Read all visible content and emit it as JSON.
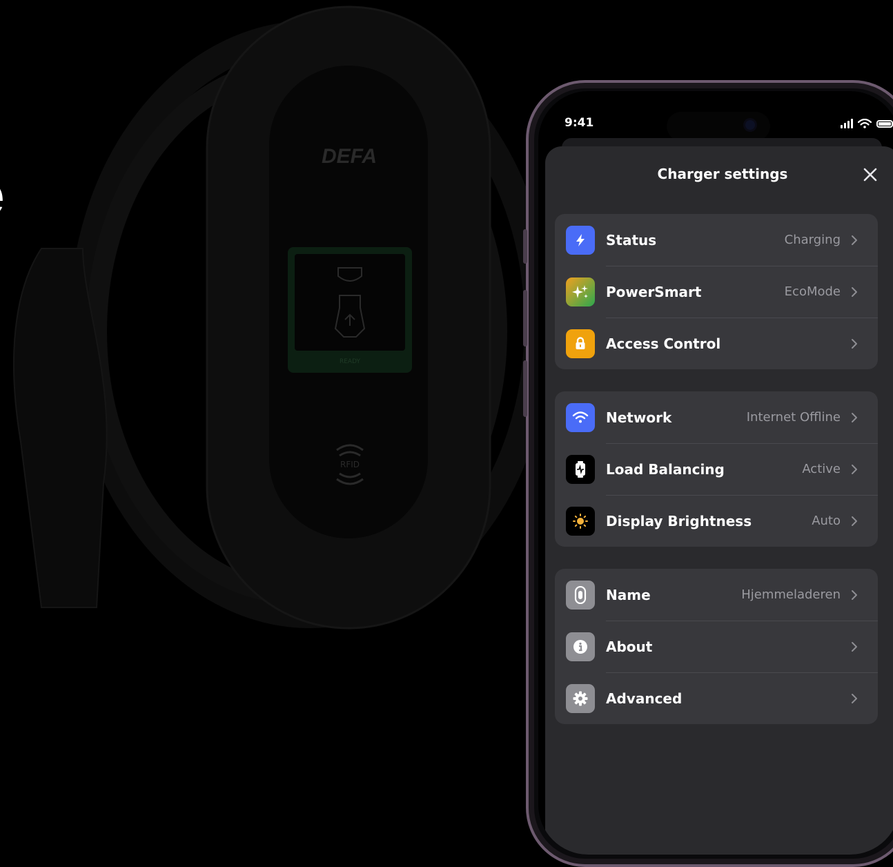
{
  "hero": {
    "line1": "e",
    "line2": "/"
  },
  "charger": {
    "brand": "DEFA",
    "ready_label": "READY",
    "rfid_label": "RFID"
  },
  "status_bar": {
    "time": "9:41"
  },
  "sheet": {
    "title": "Charger settings"
  },
  "groups": [
    [
      {
        "label": "Status",
        "value": "Charging",
        "icon": "lightning-icon",
        "color": "#4a6cf7"
      },
      {
        "label": "PowerSmart",
        "value": "EcoMode",
        "icon": "sparkles-icon",
        "color": "gradient"
      },
      {
        "label": "Access Control",
        "value": "",
        "icon": "lock-icon",
        "color": "#f0a20d"
      }
    ],
    [
      {
        "label": "Network",
        "value": "Internet Offline",
        "icon": "wifi-icon",
        "color": "#4a6cf7"
      },
      {
        "label": "Load Balancing",
        "value": "Active",
        "icon": "load-balancing-icon",
        "color": "#000000"
      },
      {
        "label": "Display Brightness",
        "value": "Auto",
        "icon": "sun-icon",
        "color": "#000000"
      }
    ],
    [
      {
        "label": "Name",
        "value": "Hjemmeladeren",
        "icon": "charger-icon",
        "color": "#8e8e93"
      },
      {
        "label": "About",
        "value": "",
        "icon": "info-icon",
        "color": "#8e8e93"
      },
      {
        "label": "Advanced",
        "value": "",
        "icon": "gear-icon",
        "color": "#8e8e93"
      }
    ]
  ]
}
